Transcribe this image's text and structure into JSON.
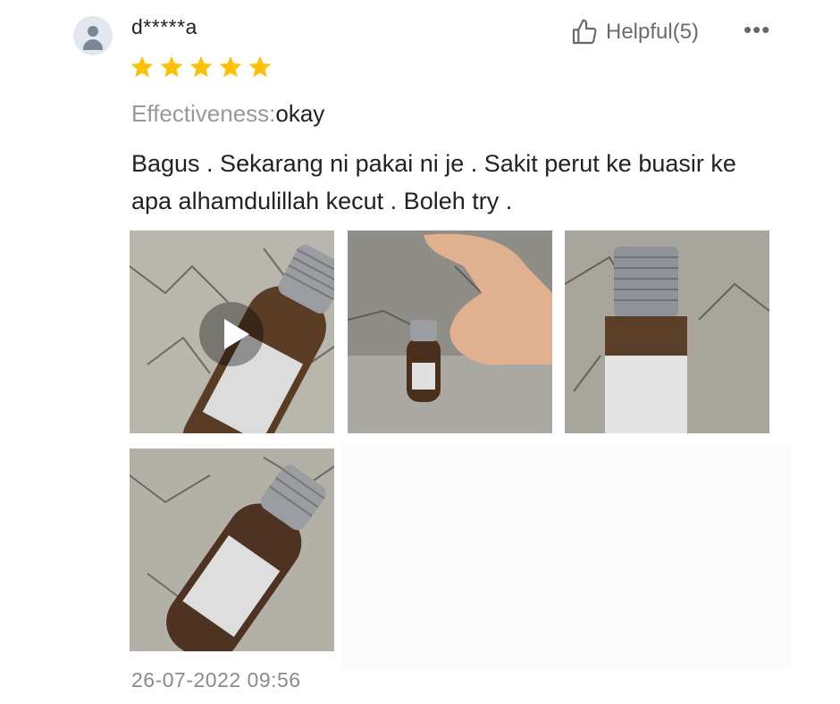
{
  "review": {
    "username": "d*****a",
    "rating": 5,
    "helpful_label": "Helpful(5)",
    "more_label": "•••",
    "effectiveness_label": "Effectiveness:",
    "effectiveness_value": "okay",
    "text": "Bagus . Sekarang ni pakai ni je . Sakit perut ke buasir ke apa alhamdulillah kecut . Boleh try .",
    "timestamp": "26-07-2022 09:56",
    "colors": {
      "star": "#FFC107",
      "muted": "#999999",
      "text": "#222222"
    },
    "media": [
      {
        "type": "video-thumbnail"
      },
      {
        "type": "photo"
      },
      {
        "type": "photo"
      },
      {
        "type": "photo"
      }
    ]
  }
}
